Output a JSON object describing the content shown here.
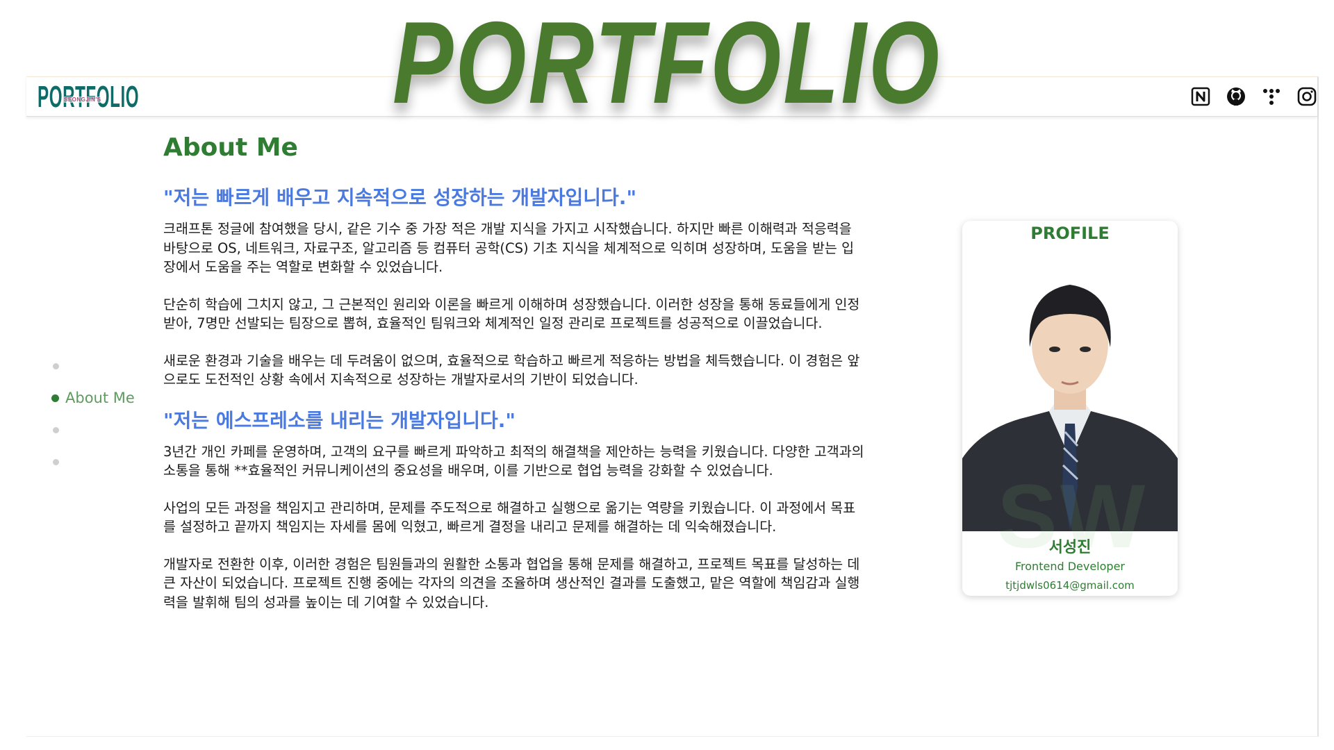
{
  "hero": {
    "title": "PORTFOLIO"
  },
  "logo": {
    "main": "PORTFOLIO",
    "sub": "SEONGJIN'S"
  },
  "social": [
    {
      "name": "notion-icon"
    },
    {
      "name": "github-icon"
    },
    {
      "name": "figma-dots-icon"
    },
    {
      "name": "instagram-icon"
    }
  ],
  "side_nav": [
    {
      "label": "",
      "active": false
    },
    {
      "label": "About Me",
      "active": true
    },
    {
      "label": "",
      "active": false
    },
    {
      "label": "",
      "active": false
    }
  ],
  "about": {
    "title": "About Me",
    "quote1": "\"저는 빠르게 배우고 지속적으로 성장하는 개발자입니다.\"",
    "paragraphs1": [
      "크래프톤 정글에 참여했을 당시, 같은 기수 중 가장 적은 개발 지식을 가지고 시작했습니다. 하지만 빠른 이해력과 적응력을 바탕으로 OS, 네트워크, 자료구조, 알고리즘 등 컴퓨터 공학(CS) 기초 지식을 체계적으로 익히며 성장하며, 도움을 받는 입장에서 도움을 주는 역할로 변화할 수 있었습니다.",
      "단순히 학습에 그치지 않고, 그 근본적인 원리와 이론을 빠르게 이해하며 성장했습니다. 이러한 성장을 통해 동료들에게 인정받아, 7명만 선발되는 팀장으로 뽑혀, 효율적인 팀워크와 체계적인 일정 관리로 프로젝트를 성공적으로 이끌었습니다.",
      "새로운 환경과 기술을 배우는 데 두려움이 없으며, 효율적으로 학습하고 빠르게 적응하는 방법을 체득했습니다. 이 경험은 앞으로도 도전적인 상황 속에서 지속적으로 성장하는 개발자로서의 기반이 되었습니다."
    ],
    "quote2": "\"저는 에스프레소를 내리는 개발자입니다.\"",
    "paragraphs2": [
      "3년간 개인 카페를 운영하며, 고객의 요구를 빠르게 파악하고 최적의 해결책을 제안하는 능력을 키웠습니다. 다양한 고객과의 소통을 통해 **효율적인 커뮤니케이션의 중요성을 배우며, 이를 기반으로 협업 능력을 강화할 수 있었습니다.",
      "사업의 모든 과정을 책임지고 관리하며, 문제를 주도적으로 해결하고 실행으로 옮기는 역량을 키웠습니다. 이 과정에서 목표를 설정하고 끝까지 책임지는 자세를 몸에 익혔고, 빠르게 결정을 내리고 문제를 해결하는 데 익숙해졌습니다.",
      "개발자로 전환한 이후, 이러한 경험은 팀원들과의 원활한 소통과 협업을 통해 문제를 해결하고, 프로젝트 목표를 달성하는 데 큰 자산이 되었습니다. 프로젝트 진행 중에는 각자의 의견을 조율하며 생산적인 결과를 도출했고, 맡은 역할에 책임감과 실행력을 발휘해 팀의 성과를 높이는 데 기여할 수 있었습니다."
    ]
  },
  "profile": {
    "heading": "PROFILE",
    "watermark": "SW",
    "name": "서성진",
    "role": "Frontend Developer",
    "email": "tjtjdwls0614@gmail.com"
  },
  "colors": {
    "accent": "#2e7d32",
    "hero": "#4a7a2e",
    "quote": "#4a7ae0"
  }
}
